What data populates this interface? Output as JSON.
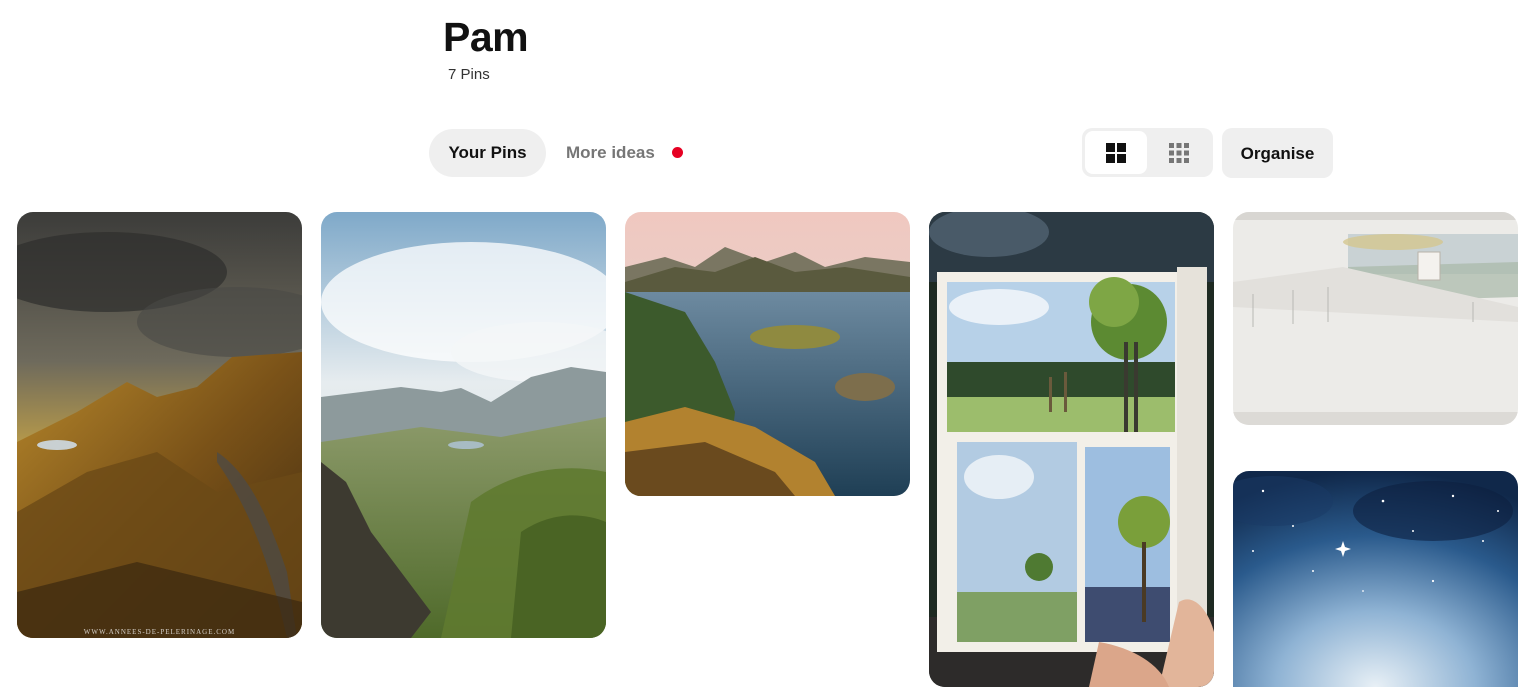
{
  "board": {
    "title": "Pam",
    "pin_count": "7 Pins"
  },
  "tabs": {
    "your_pins": "Your Pins",
    "more_ideas": "More ideas"
  },
  "toolbar": {
    "organise_label": "Organise",
    "view_options": [
      "default-grid-icon",
      "compact-grid-icon"
    ],
    "active_view": "default-grid-icon"
  },
  "pins": [
    {
      "name": "pin-quiraing-sunset",
      "watermark": "WWW.ANNEES-DE-PELERINAGE.COM"
    },
    {
      "name": "pin-quiraing-green-valley"
    },
    {
      "name": "pin-fjord-islands"
    },
    {
      "name": "pin-watercolor-sketchbook"
    },
    {
      "name": "pin-watercolor-landscape-sketch"
    },
    {
      "name": "pin-watercolor-night-sky"
    }
  ],
  "colors": {
    "accent_dot": "#e60023",
    "tab_bg": "#efefef",
    "muted_text": "#767676"
  }
}
